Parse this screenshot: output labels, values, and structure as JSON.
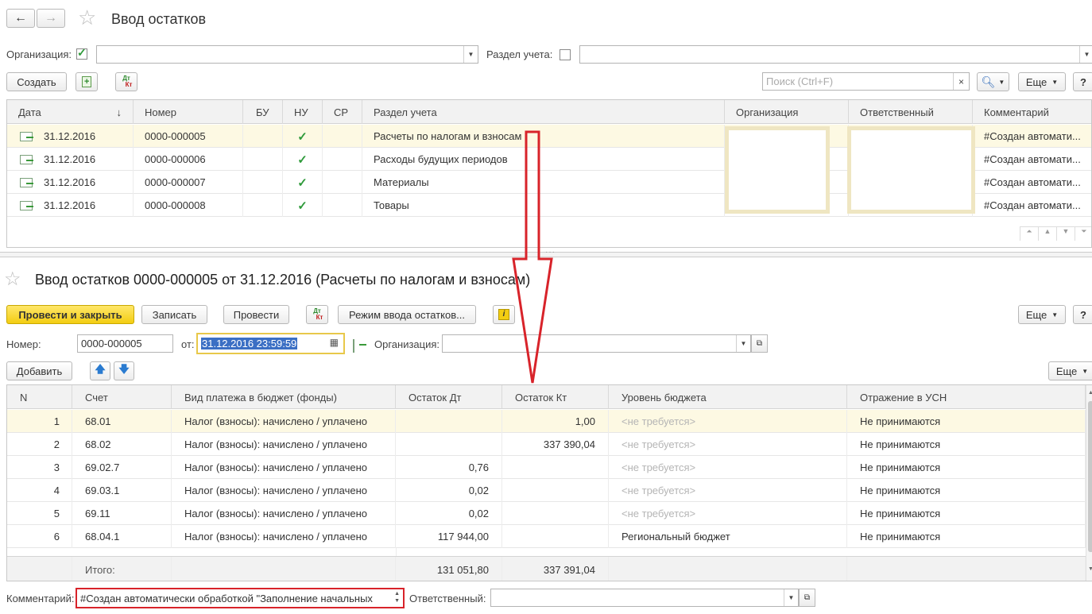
{
  "list": {
    "title": "Ввод остатков",
    "filter_org_label": "Организация:",
    "filter_org_value": "",
    "filter_section_label": "Раздел учета:",
    "filter_section_value": "",
    "create_label": "Создать",
    "dtkt_label_top": "Дт",
    "dtkt_label_bottom": "Кт",
    "search_placeholder": "Поиск (Ctrl+F)",
    "search_clear": "×",
    "more_label": "Еще",
    "help_label": "?",
    "columns": [
      "Дата",
      "Номер",
      "БУ",
      "НУ",
      "СР",
      "Раздел учета",
      "Организация",
      "Ответственный",
      "Комментарий"
    ],
    "rows": [
      {
        "date": "31.12.2016",
        "number": "0000-000005",
        "bu": "",
        "nu": "✓",
        "sr": "",
        "section": "Расчеты по налогам и взносам",
        "org": "",
        "resp": "",
        "comment": "#Создан автомати..."
      },
      {
        "date": "31.12.2016",
        "number": "0000-000006",
        "bu": "",
        "nu": "✓",
        "sr": "",
        "section": "Расходы будущих периодов",
        "org": "",
        "resp": "",
        "comment": "#Создан автомати..."
      },
      {
        "date": "31.12.2016",
        "number": "0000-000007",
        "bu": "",
        "nu": "✓",
        "sr": "",
        "section": "Материалы",
        "org": "",
        "resp": "",
        "comment": "#Создан автомати..."
      },
      {
        "date": "31.12.2016",
        "number": "0000-000008",
        "bu": "",
        "nu": "✓",
        "sr": "",
        "section": "Товары",
        "org": "",
        "resp": "",
        "comment": "#Создан автомати..."
      }
    ]
  },
  "doc": {
    "title": "Ввод остатков 0000-000005 от 31.12.2016 (Расчеты по налогам и взносам)",
    "post_close_label": "Провести и закрыть",
    "save_label": "Записать",
    "post_label": "Провести",
    "mode_label": "Режим ввода остатков...",
    "info_label": "i",
    "more_label": "Еще",
    "help_label": "?",
    "number_label": "Номер:",
    "number_value": "0000-000005",
    "from_label": "от:",
    "date_value": "31.12.2016 23:59:59",
    "org_label": "Организация:",
    "org_value": "",
    "add_label": "Добавить",
    "columns": [
      "N",
      "Счет",
      "Вид платежа в бюджет (фонды)",
      "Остаток Дт",
      "Остаток Кт",
      "Уровень бюджета",
      "Отражение в УСН"
    ],
    "rows": [
      {
        "n": "1",
        "account": "68.01",
        "kind": "Налог (взносы): начислено / уплачено",
        "dt": "",
        "kt": "1,00",
        "level": "<не требуется>",
        "usn": "Не принимаются"
      },
      {
        "n": "2",
        "account": "68.02",
        "kind": "Налог (взносы): начислено / уплачено",
        "dt": "",
        "kt": "337 390,04",
        "level": "<не требуется>",
        "usn": "Не принимаются"
      },
      {
        "n": "3",
        "account": "69.02.7",
        "kind": "Налог (взносы): начислено / уплачено",
        "dt": "0,76",
        "kt": "",
        "level": "<не требуется>",
        "usn": "Не принимаются"
      },
      {
        "n": "4",
        "account": "69.03.1",
        "kind": "Налог (взносы): начислено / уплачено",
        "dt": "0,02",
        "kt": "",
        "level": "<не требуется>",
        "usn": "Не принимаются"
      },
      {
        "n": "5",
        "account": "69.11",
        "kind": "Налог (взносы): начислено / уплачено",
        "dt": "0,02",
        "kt": "",
        "level": "<не требуется>",
        "usn": "Не принимаются"
      },
      {
        "n": "6",
        "account": "68.04.1",
        "kind": "Налог (взносы): начислено / уплачено",
        "dt": "117 944,00",
        "kt": "",
        "level": "Региональный бюджет",
        "usn": "Не принимаются"
      }
    ],
    "total_label": "Итого:",
    "total_dt": "131 051,80",
    "total_kt": "337 391,04",
    "comment_label": "Комментарий:",
    "comment_value": "#Создан автоматически обработкой \"Заполнение начальных",
    "resp_label": "Ответственный:",
    "resp_value": ""
  },
  "colors": {
    "accent_yellow": "#f3cd12",
    "selected_row": "#fdf9e3",
    "annotation_red": "#d8232a",
    "check_green": "#2e9a3a"
  }
}
